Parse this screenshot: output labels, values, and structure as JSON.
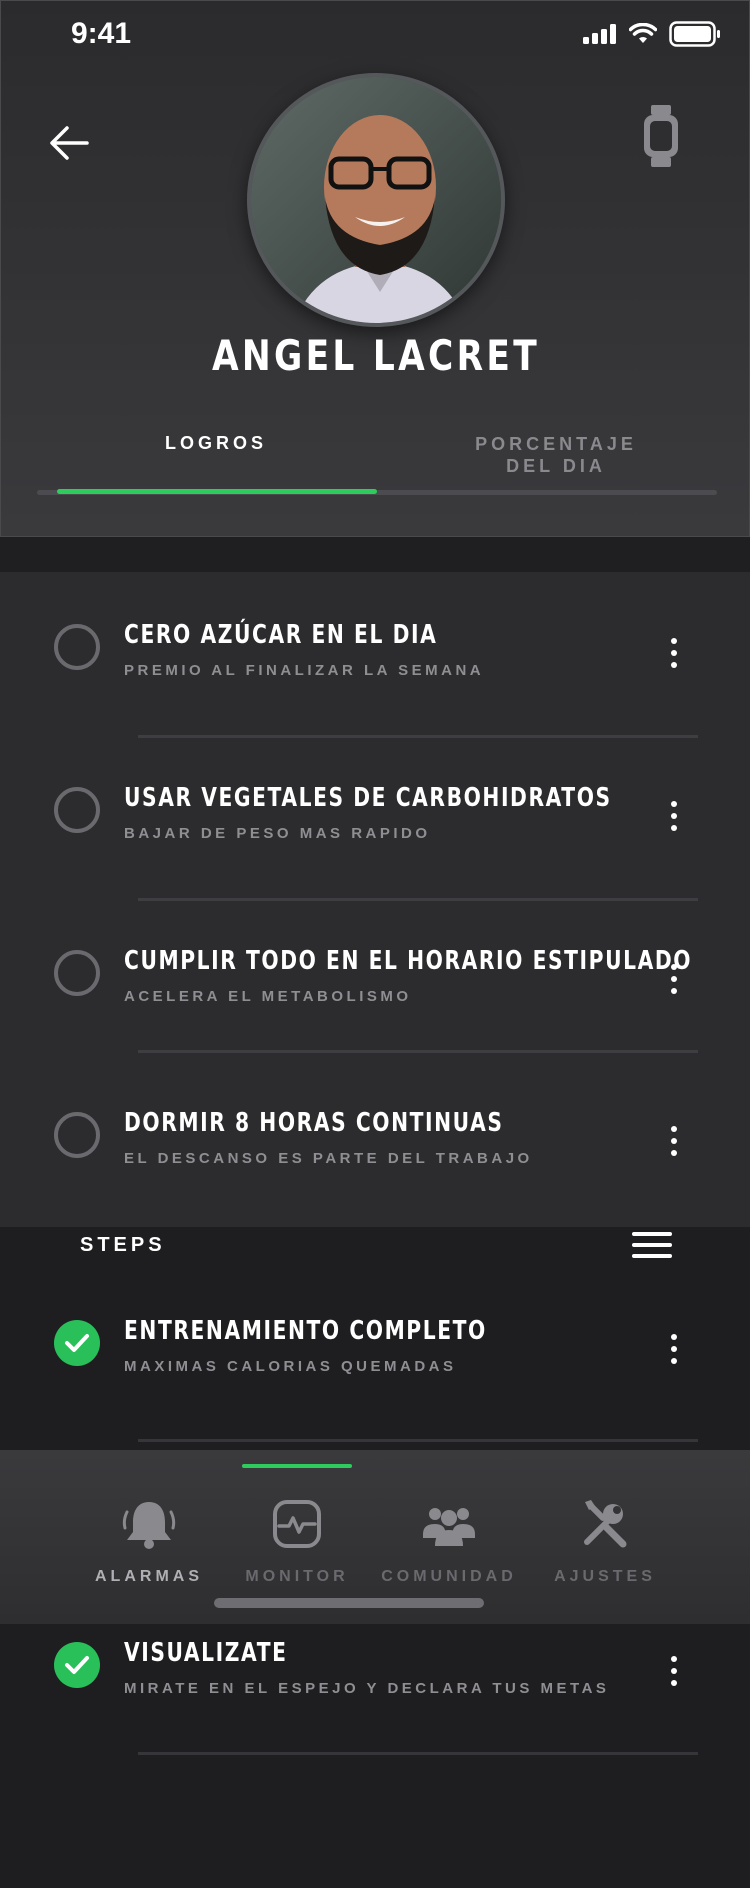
{
  "status_bar": {
    "time": "9:41"
  },
  "profile": {
    "name": "ANGEL LACRET"
  },
  "tabs": [
    {
      "label": "LOGROS",
      "active": true
    },
    {
      "label": "PORCENTAJE DEL DIA",
      "active": false
    }
  ],
  "accent_color": "#2ecc5c",
  "items": [
    {
      "title": "CERO AZÚCAR EN EL DIA",
      "subtitle": "PREMIO AL FINALIZAR LA SEMANA",
      "done": false
    },
    {
      "title": "USAR VEGETALES DE CARBOHIDRATOS",
      "subtitle": "BAJAR DE PESO MAS RAPIDO",
      "done": false
    },
    {
      "title": "CUMPLIR TODO EN EL HORARIO ESTIPULADO",
      "subtitle": "ACELERA EL METABOLISMO",
      "done": false
    },
    {
      "title": "DORMIR 8 HORAS CONTINUAS",
      "subtitle": "EL DESCANSO ES PARTE DEL TRABAJO",
      "done": false
    }
  ],
  "steps": {
    "label": "STEPS",
    "items": [
      {
        "title": "ENTRENAMIENTO COMPLETO",
        "subtitle": "MAXIMAS CALORIAS QUEMADAS",
        "done": true
      },
      {
        "title": "VISUALIZATE",
        "subtitle": "MIRATE EN EL ESPEJO Y DECLARA TUS METAS",
        "done": true
      }
    ]
  },
  "bottom_nav": [
    {
      "label": "ALARMAS",
      "icon": "bell-icon",
      "active": true
    },
    {
      "label": "MONITOR",
      "icon": "heart-monitor-icon",
      "active": false
    },
    {
      "label": "COMUNIDAD",
      "icon": "community-icon",
      "active": false
    },
    {
      "label": "AJUSTES",
      "icon": "tools-icon",
      "active": false
    }
  ]
}
